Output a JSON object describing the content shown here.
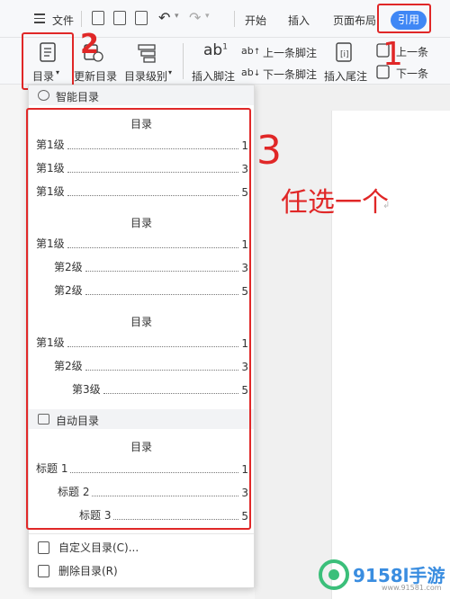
{
  "toolbar": {
    "menu_label": "文件",
    "tabs": [
      "开始",
      "插入",
      "页面布局",
      "引用"
    ]
  },
  "ribbon": {
    "toc_button": "目录",
    "update_toc": "更新目录",
    "toc_level": "目录级别",
    "insert_footnote": "插入脚注",
    "prev_footnote": "上一条脚注",
    "next_footnote": "下一条脚注",
    "insert_endnote": "插入尾注",
    "prev_more": "上一条",
    "next_more": "下一条"
  },
  "dropdown": {
    "smart_toc_header": "智能目录",
    "auto_toc_header": "自动目录",
    "custom_toc": "自定义目录(C)...",
    "delete_toc": "删除目录(R)",
    "toc_title": "目录",
    "style1": [
      {
        "text": "第1级",
        "page": "1"
      },
      {
        "text": "第1级",
        "page": "3"
      },
      {
        "text": "第1级",
        "page": "5"
      }
    ],
    "style2": [
      {
        "text": "第1级",
        "page": "1"
      },
      {
        "text": "第2级",
        "page": "3"
      },
      {
        "text": "第2级",
        "page": "5"
      }
    ],
    "style3": [
      {
        "text": "第1级",
        "page": "1"
      },
      {
        "text": "第2级",
        "page": "3"
      },
      {
        "text": "第3级",
        "page": "5"
      }
    ],
    "auto": [
      {
        "text": "标题 1",
        "page": "1"
      },
      {
        "text": "标题 2",
        "page": "3"
      },
      {
        "text": "标题 3",
        "page": "5"
      }
    ]
  },
  "annotations": {
    "step1": "1",
    "step2": "2",
    "step3": "3",
    "choose_any": "任选一个"
  },
  "watermark": {
    "brand": "9158l手游",
    "url": "www.91581.com"
  },
  "colors": {
    "accent": "#3f87f5",
    "annotation_red": "#e02727"
  }
}
